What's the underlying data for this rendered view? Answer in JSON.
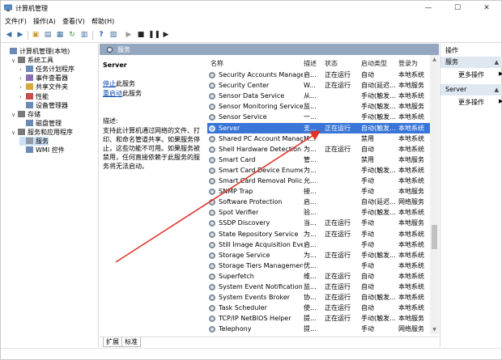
{
  "window": {
    "title": "计算机管理",
    "minimize": "—",
    "maximize": "☐",
    "close": "✕"
  },
  "menu": [
    "文件(F)",
    "操作(A)",
    "查看(V)",
    "帮助(H)"
  ],
  "tree": [
    {
      "label": "计算机管理(本地)",
      "level": 0,
      "exp": ""
    },
    {
      "label": "系统工具",
      "level": 1,
      "exp": "∨"
    },
    {
      "label": "任务计划程序",
      "level": 2,
      "exp": "›"
    },
    {
      "label": "事件查看器",
      "level": 2,
      "exp": "›"
    },
    {
      "label": "共享文件夹",
      "level": 2,
      "exp": "›"
    },
    {
      "label": "性能",
      "level": 2,
      "exp": "›"
    },
    {
      "label": "设备管理器",
      "level": 2,
      "exp": ""
    },
    {
      "label": "存储",
      "level": 1,
      "exp": "∨"
    },
    {
      "label": "磁盘管理",
      "level": 2,
      "exp": ""
    },
    {
      "label": "服务和应用程序",
      "level": 1,
      "exp": "∨"
    },
    {
      "label": "服务",
      "level": 2,
      "exp": "",
      "selected": true
    },
    {
      "label": "WMI 控件",
      "level": 2,
      "exp": ""
    }
  ],
  "middle": {
    "header": "服务",
    "service_title": "Server",
    "stop_link": "停止",
    "stop_suffix": "此服务",
    "restart_link": "重启动",
    "restart_suffix": "此服务",
    "desc_label": "描述:",
    "desc_text": "支持此计算机通过网络的文件、打印、和命名管道共享。如果服务停止，这些功能不可用。如果服务被禁用，任何直接依赖于此服务的服务将无法启动。",
    "columns": [
      "名称",
      "描述",
      "状态",
      "启动类型",
      "登录为"
    ],
    "rows": [
      [
        "Security Accounts Manager",
        "启...",
        "正在运行",
        "自动",
        "本地系统"
      ],
      [
        "Security Center",
        "W...",
        "正在运行",
        "自动(延迟...",
        "本地服务"
      ],
      [
        "Sensor Data Service",
        "从...",
        "",
        "手动(触发...",
        "本地系统"
      ],
      [
        "Sensor Monitoring Service",
        "监...",
        "",
        "手动(触发...",
        "本地服务"
      ],
      [
        "Sensor Service",
        "一...",
        "",
        "手动(触发...",
        "本地系统"
      ],
      [
        "Server",
        "支...",
        "正在运行",
        "自动(触发...",
        "本地系统"
      ],
      [
        "Shared PC Account Manager",
        "M...",
        "",
        "禁用",
        "本地系统"
      ],
      [
        "Shell Hardware Detection",
        "为...",
        "正在运行",
        "自动",
        "本地系统"
      ],
      [
        "Smart Card",
        "管...",
        "",
        "禁用",
        "本地服务"
      ],
      [
        "Smart Card Device Enumer...",
        "为...",
        "",
        "手动(触发...",
        "本地系统"
      ],
      [
        "Smart Card Removal Policy",
        "允...",
        "",
        "手动",
        "本地系统"
      ],
      [
        "SNMP Trap",
        "接...",
        "",
        "手动",
        "本地服务"
      ],
      [
        "Software Protection",
        "启...",
        "",
        "自动(延迟...",
        "网络服务"
      ],
      [
        "Spot Verifier",
        "验...",
        "",
        "手动(触发...",
        "本地系统"
      ],
      [
        "SSDP Discovery",
        "当...",
        "正在运行",
        "手动",
        "本地服务"
      ],
      [
        "State Repository Service",
        "为...",
        "正在运行",
        "手动",
        "本地系统"
      ],
      [
        "Still Image Acquisition Eve...",
        "启...",
        "",
        "手动",
        "本地系统"
      ],
      [
        "Storage Service",
        "为...",
        "正在运行",
        "手动(触发...",
        "本地系统"
      ],
      [
        "Storage Tiers Management",
        "优...",
        "",
        "手动",
        "本地系统"
      ],
      [
        "Superfetch",
        "维...",
        "正在运行",
        "自动",
        "本地系统"
      ],
      [
        "System Event Notification ...",
        "监...",
        "正在运行",
        "自动",
        "本地系统"
      ],
      [
        "System Events Broker",
        "协...",
        "正在运行",
        "自动(触发...",
        "本地系统"
      ],
      [
        "Task Scheduler",
        "使...",
        "正在运行",
        "自动",
        "本地系统"
      ],
      [
        "TCP/IP NetBIOS Helper",
        "提...",
        "正在运行",
        "手动(触发...",
        "本地服务"
      ],
      [
        "Telephony",
        "提...",
        "",
        "手动",
        "网络服务"
      ]
    ],
    "selected_row": 5,
    "tabs": [
      "扩展",
      "标准"
    ]
  },
  "actions": {
    "header": "操作",
    "sec1": "服务",
    "more1": "更多操作",
    "sec2": "Server",
    "more2": "更多操作"
  },
  "colors": {
    "selection": "#3875d7",
    "header": "#94a7c0",
    "arrow": "#e0342a"
  }
}
